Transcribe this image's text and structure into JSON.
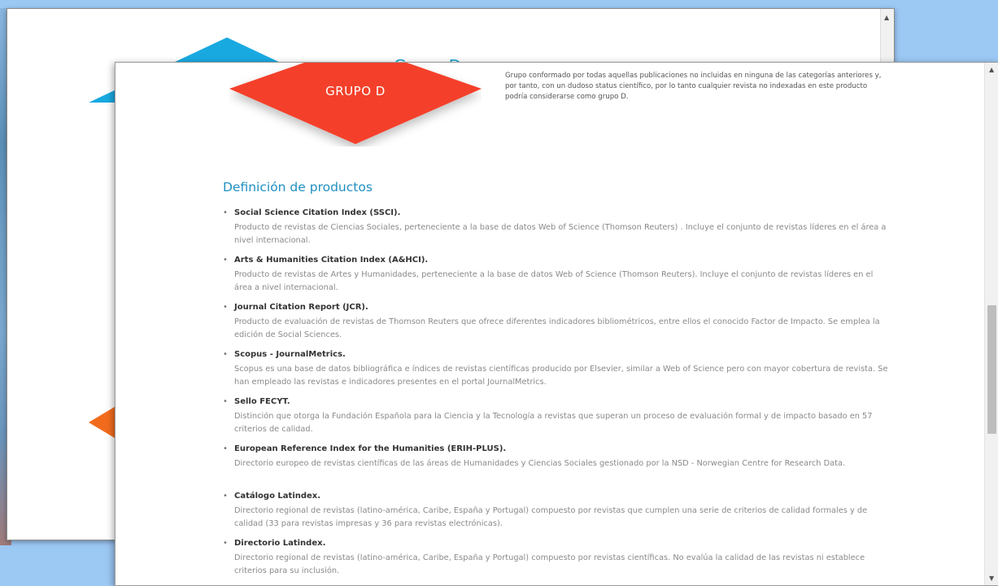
{
  "background_window": {
    "title_partial": "Grupo D",
    "colors": {
      "blue_diamond": "#19a9e1",
      "orange_diamond": "#f26b1d"
    }
  },
  "grupo": {
    "label": "GRUPO D",
    "color": "#f4412a",
    "description": "Grupo conformado por todas aquellas publicaciones no incluidas en ninguna de las categorías anteriores y, por tanto, con un dudoso status científico, por lo tanto cualquier revista no indexadas en este producto podría considerarse como grupo D."
  },
  "section": {
    "title": "Definición de productos"
  },
  "products": [
    {
      "name": "Social Science Citation Index (SSCI).",
      "description": "Producto de revistas de Ciencias Sociales, perteneciente a la base de datos Web of Science (Thomson Reuters) . Incluye el conjunto de revistas líderes en el área a nivel internacional."
    },
    {
      "name": "Arts & Humanities Citation Index (A&HCI).",
      "description": "Producto de revistas de Artes y Humanidades, perteneciente a la base de datos Web of Science (Thomson Reuters). Incluye el conjunto de revistas líderes en el área a nivel internacional."
    },
    {
      "name": "Journal Citation Report (JCR).",
      "description": "Producto de evaluación de revistas de Thomson Reuters que ofrece diferentes indicadores bibliométricos, entre ellos el conocido Factor de Impacto. Se emplea la edición de Social Sciences."
    },
    {
      "name": "Scopus - JournalMetrics.",
      "description": "Scopus es una base de datos bibliográfica e índices de revistas científicas producido por Elsevier, similar a Web of Science pero con mayor cobertura de revista. Se han empleado las revistas e indicadores presentes en el portal JournalMetrics."
    },
    {
      "name": "Sello FECYT.",
      "description": "Distinción que otorga la Fundación Española para la Ciencia y la Tecnología a revistas que superan un proceso de evaluación formal y de impacto basado en 57 criterios de calidad."
    },
    {
      "name": "European Reference Index for the Humanities (ERIH-PLUS).",
      "description": "Directorio europeo de revistas científicas de las áreas de Humanidades y Ciencias Sociales gestionado por la NSD - Norwegian Centre for Research Data."
    },
    {
      "name": "Catálogo Latindex.",
      "description": "Directorio regional de revistas (latino-américa, Caribe, España y Portugal) compuesto por revistas que cumplen una serie de criterios de calidad formales y de calidad (33 para revistas impresas y 36 para revistas electrónicas)."
    },
    {
      "name": "Directorio Latindex.",
      "description": "Directorio regional de revistas (latino-américa, Caribe, España y Portugal) compuesto por revistas científicas. No evalúa la calidad de las revistas ni establece criterios para su inclusión."
    }
  ]
}
